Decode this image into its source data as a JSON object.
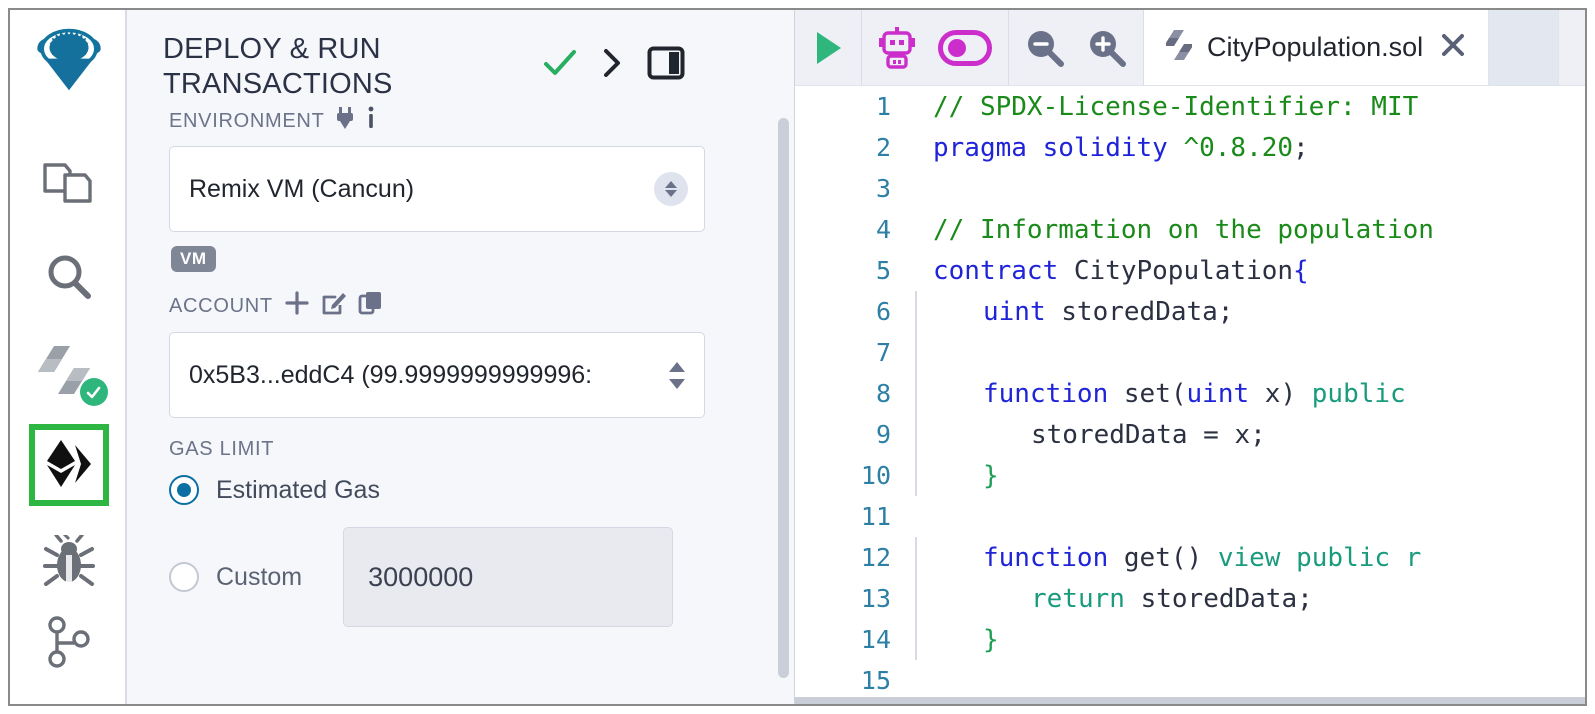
{
  "sidebar": {
    "logo_name": "remix-logo",
    "items": [
      {
        "name": "file-explorer",
        "label": "File explorer"
      },
      {
        "name": "search",
        "label": "Search in files"
      },
      {
        "name": "solidity-compiler",
        "label": "Solidity compiler"
      },
      {
        "name": "deploy-run-transactions",
        "label": "Deploy & run transactions"
      },
      {
        "name": "debugger",
        "label": "Debugger"
      },
      {
        "name": "git",
        "label": "Git"
      }
    ],
    "selected": "deploy-run-transactions",
    "selection_color": "#2db742",
    "compiler_badge_color": "#2eb67d"
  },
  "panel": {
    "title": "DEPLOY & RUN TRANSACTIONS",
    "header_icons": [
      {
        "name": "check-icon",
        "glyph": "check",
        "color": "#27ae60"
      },
      {
        "name": "chevron-right-icon",
        "glyph": "chevron-right",
        "color": "#21252e"
      },
      {
        "name": "panel-layout-icon",
        "glyph": "panel",
        "color": "#21252e"
      }
    ],
    "environment": {
      "label": "ENVIRONMENT",
      "icons": [
        "plug-icon",
        "info-icon"
      ],
      "value": "Remix VM (Cancun)",
      "tag": "VM"
    },
    "account": {
      "label": "ACCOUNT",
      "icons": [
        "plus-icon",
        "edit-icon",
        "copy-icon"
      ],
      "value": "0x5B3...eddC4 (99.9999999999996:"
    },
    "gas_limit": {
      "label": "GAS LIMIT",
      "options": [
        {
          "label": "Estimated Gas",
          "selected": true
        },
        {
          "label": "Custom",
          "selected": false
        }
      ],
      "custom_value": "3000000",
      "radio_color": "#0b6fa4"
    }
  },
  "editor": {
    "toolbar": [
      {
        "name": "run-script-button",
        "glyph": "play",
        "color": "#2eb67d"
      },
      {
        "name": "ai-assistant-button",
        "glyph": "robot",
        "color": "#cc2ecc"
      },
      {
        "name": "ai-toggle-switch",
        "glyph": "toggle-on",
        "color": "#cc2ecc"
      },
      {
        "name": "zoom-out-button",
        "glyph": "zoom-out",
        "color": "#6b7189"
      },
      {
        "name": "zoom-in-button",
        "glyph": "zoom-in",
        "color": "#6b7189"
      }
    ],
    "tab": {
      "icon": "solidity-icon",
      "name": "CityPopulation.sol",
      "close": "close-icon"
    },
    "code_lines": [
      {
        "n": "1",
        "indent": 0,
        "guide": false,
        "tokens": [
          {
            "t": "// SPDX-License-Identifier: MIT",
            "c": "cmt"
          }
        ]
      },
      {
        "n": "2",
        "indent": 0,
        "guide": false,
        "tokens": [
          {
            "t": "pragma",
            "c": "kw"
          },
          {
            "t": " ",
            "c": "pun"
          },
          {
            "t": "solidity",
            "c": "kw"
          },
          {
            "t": " ",
            "c": "pun"
          },
          {
            "t": "^0.8.20",
            "c": "num"
          },
          {
            "t": ";",
            "c": "pun"
          }
        ]
      },
      {
        "n": "3",
        "indent": 0,
        "guide": false,
        "tokens": []
      },
      {
        "n": "4",
        "indent": 0,
        "guide": false,
        "tokens": [
          {
            "t": "// Information on the population",
            "c": "cmt"
          }
        ]
      },
      {
        "n": "5",
        "indent": 0,
        "guide": false,
        "tokens": [
          {
            "t": "contract",
            "c": "kw"
          },
          {
            "t": " ",
            "c": "pun"
          },
          {
            "t": "CityPopulation",
            "c": "id"
          },
          {
            "t": "{",
            "c": "kw"
          }
        ]
      },
      {
        "n": "6",
        "indent": 1,
        "guide": true,
        "tokens": [
          {
            "t": "uint",
            "c": "typ"
          },
          {
            "t": " storedData;",
            "c": "id"
          }
        ]
      },
      {
        "n": "7",
        "indent": 1,
        "guide": true,
        "tokens": []
      },
      {
        "n": "8",
        "indent": 1,
        "guide": true,
        "tokens": [
          {
            "t": "function",
            "c": "kw"
          },
          {
            "t": " ",
            "c": "pun"
          },
          {
            "t": "set",
            "c": "id"
          },
          {
            "t": "(",
            "c": "pun"
          },
          {
            "t": "uint",
            "c": "typ"
          },
          {
            "t": " x",
            "c": "id"
          },
          {
            "t": ") ",
            "c": "pun"
          },
          {
            "t": "public",
            "c": "kw2"
          }
        ]
      },
      {
        "n": "9",
        "indent": 2,
        "guide": true,
        "tokens": [
          {
            "t": "storedData = x;",
            "c": "id"
          }
        ]
      },
      {
        "n": "10",
        "indent": 1,
        "guide": true,
        "tokens": [
          {
            "t": "}",
            "c": "brc"
          }
        ]
      },
      {
        "n": "11",
        "indent": 1,
        "guide": false,
        "tokens": []
      },
      {
        "n": "12",
        "indent": 1,
        "guide": true,
        "tokens": [
          {
            "t": "function",
            "c": "kw"
          },
          {
            "t": " ",
            "c": "pun"
          },
          {
            "t": "get",
            "c": "id"
          },
          {
            "t": "() ",
            "c": "pun"
          },
          {
            "t": "view",
            "c": "kw2"
          },
          {
            "t": " ",
            "c": "pun"
          },
          {
            "t": "public",
            "c": "kw2"
          },
          {
            "t": " r",
            "c": "kw2"
          }
        ]
      },
      {
        "n": "13",
        "indent": 2,
        "guide": true,
        "tokens": [
          {
            "t": "return",
            "c": "kw2"
          },
          {
            "t": " storedData;",
            "c": "id"
          }
        ]
      },
      {
        "n": "14",
        "indent": 1,
        "guide": true,
        "tokens": [
          {
            "t": "}",
            "c": "brc"
          }
        ]
      },
      {
        "n": "15",
        "indent": 0,
        "guide": false,
        "tokens": []
      }
    ]
  }
}
